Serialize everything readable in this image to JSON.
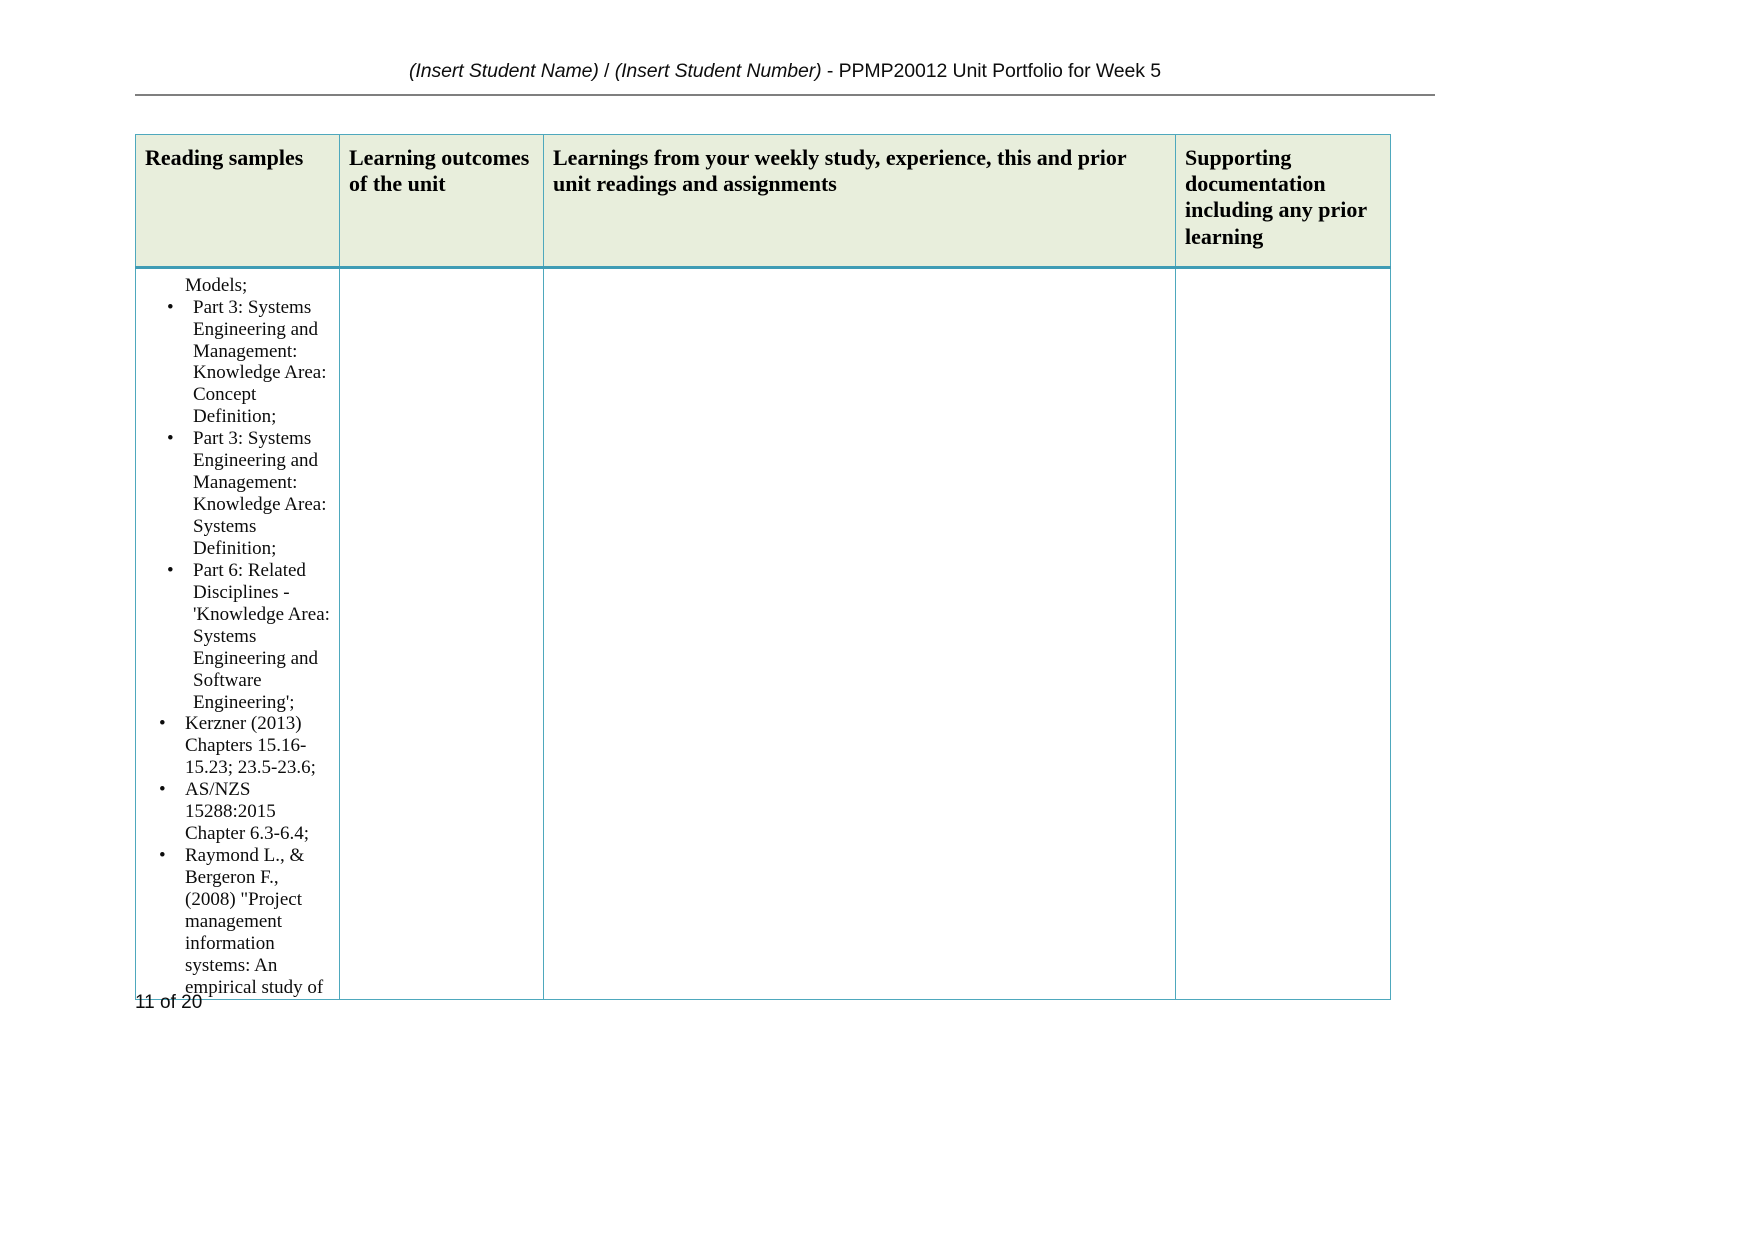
{
  "document": {
    "header": {
      "student_name_placeholder": "(Insert Student Name)",
      "separator": " / ",
      "student_number_placeholder": "(Insert Student Number)",
      "suffix": " - PPMP20012 Unit Portfolio for Week 5",
      "full_text": "(Insert Student Name) / (Insert Student Number) - PPMP20012 Unit Portfolio for Week 5"
    },
    "footer": {
      "page_indicator": "11 of 20"
    }
  },
  "table": {
    "headers": [
      "Reading samples",
      "Learning outcomes of the unit",
      "Learnings from your weekly study, experience, this and prior unit readings and assignments",
      "Supporting documentation including any prior learning"
    ],
    "rows": [
      {
        "reading_samples": {
          "continuation_line": "Models;",
          "bullets": [
            "Part 3: Systems Engineering and Management: Knowledge Area: Concept Definition;",
            "Part 3: Systems Engineering and Management: Knowledge Area: Systems Definition;",
            "Part 6: Related Disciplines - 'Knowledge Area: Systems Engineering and Software Engineering';",
            "Kerzner (2013) Chapters 15.16-15.23; 23.5-23.6;",
            "AS/NZS 15288:2015 Chapter 6.3-6.4;",
            "Raymond L., & Bergeron F., (2008) \"Project management information systems: An empirical study of"
          ]
        },
        "learning_outcomes": "",
        "learnings": "",
        "supporting_documentation": ""
      }
    ]
  },
  "colors": {
    "table_border": "#4ea8bd",
    "header_fill": "#e8eedc",
    "header_rule": "#7f7f7f",
    "text": "#0c0c0c"
  }
}
